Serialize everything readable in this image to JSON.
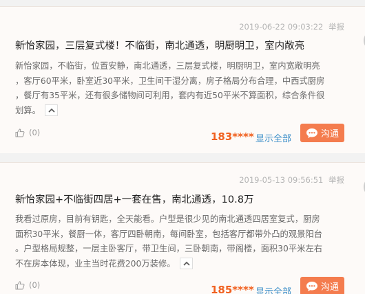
{
  "posts": [
    {
      "timestamp": "2019-06-22 09:03:22",
      "report_label": "举报",
      "title": "新怡家园，三层复式楼！不临街，南北通透，明厨明卫，室内敞亮",
      "body_lines": [
        "新怡家园，不临街，位置安静，南北通透，三层复式楼，明厨明卫，室内宽敞明亮",
        "，客厅60平米，卧室近30平米，卫生间干湿分离，房子格局分布合理，中西式厨房",
        "，餐厅有35平米，还有很多储物间可利用，套内有近50平米不算面积，综合条件很",
        "划算。"
      ],
      "like_count": "(0)",
      "phone": "183****",
      "show_all_label": "显示全部",
      "chat_label": "沟通"
    },
    {
      "timestamp": "2019-05-13 09:56:51",
      "report_label": "举报",
      "title": "新怡家园+不临街四居+一套在售，南北通透，10.8万",
      "body_lines": [
        "我看过原房，目前有钥匙，全天能看。户型是很少见的南北通透四居室复式，厨房",
        "面积30平米，餐厨一体，客厅四卧朝南，每间卧室，包括客厅都带外凸的观景阳台",
        "。户型格局规整，一层主卧客厅，带卫生间，三卧朝南，带阁楼，面积30平米左右",
        "不在房本体现，业主当时花费200万装修。"
      ],
      "like_count": "(0)",
      "phone": "185****",
      "show_all_label": "显示全部",
      "chat_label": "沟通"
    }
  ],
  "colors": {
    "accent_orange": "#f47c4e",
    "phone_orange": "#f0601f",
    "link_blue": "#3b8ec8"
  },
  "icons": {
    "like": "thumbs-up-icon",
    "collapse": "chevron-up-icon",
    "chat": "chat-bubble-icon"
  }
}
